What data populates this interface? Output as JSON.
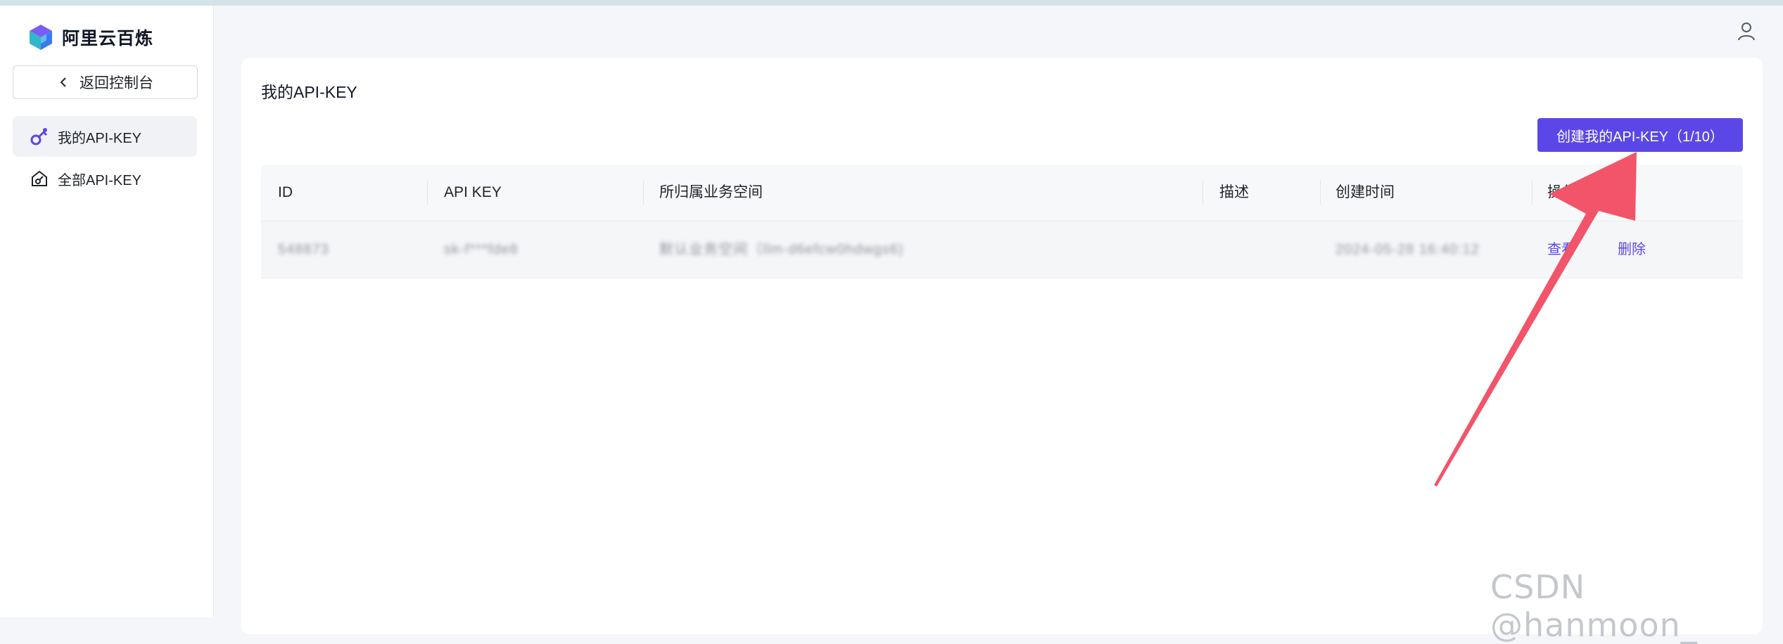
{
  "brand": {
    "name": "阿里云百炼"
  },
  "sidebar": {
    "back_label": "返回控制台",
    "items": [
      {
        "label": "我的API-KEY",
        "icon": "key-icon",
        "active": true
      },
      {
        "label": "全部API-KEY",
        "icon": "key-home-icon",
        "active": false
      }
    ]
  },
  "page": {
    "title": "我的API-KEY",
    "create_button": "创建我的API-KEY（1/10）"
  },
  "table": {
    "columns": [
      "ID",
      "API KEY",
      "所归属业务空间",
      "描述",
      "创建时间",
      "操作"
    ],
    "rows": [
      {
        "id": "548873",
        "api_key": "sk-f***fde8",
        "workspace": "默认业务空间（llm-d6efcw0hdwgs6)",
        "description": "",
        "created": "2024-05-28 16:40:12",
        "actions": [
          "查看",
          "删除"
        ]
      }
    ]
  },
  "watermark": "CSDN @hanmoon_",
  "colors": {
    "accent": "#5b47e8",
    "annotation_arrow": "#f2546a"
  }
}
